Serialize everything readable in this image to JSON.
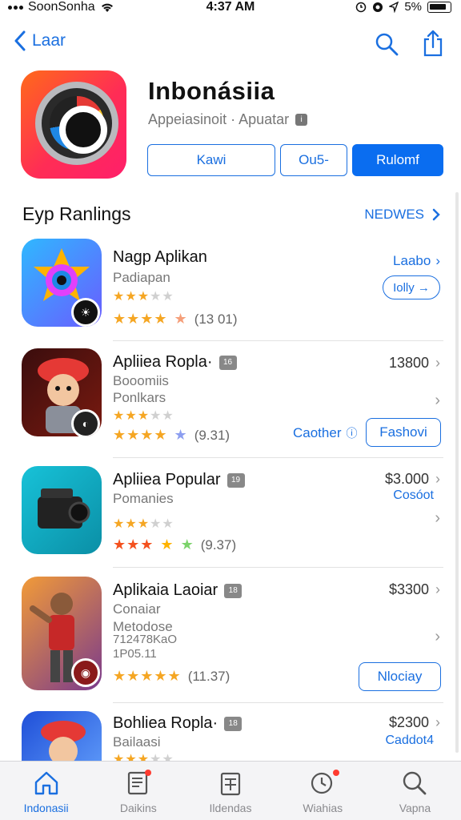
{
  "status": {
    "carrier": "SoonSonha",
    "time": "4:37 AM",
    "battery": "5%"
  },
  "nav": {
    "back_label": "Laar"
  },
  "hero": {
    "title": "Inbonásiia",
    "subtitle": "Appeiasinoit · Apuatar",
    "buttons": [
      "Kawi",
      "Ou5-",
      "Rulomf"
    ]
  },
  "section": {
    "title": "Eyp Ranlings",
    "more": "NEDWES"
  },
  "apps": [
    {
      "name": "Nagp Aplikan",
      "sub1": "Padiapan",
      "sub2": "",
      "sub3": "",
      "rating_count": "(13 01)",
      "price": "",
      "price2": "",
      "link": "Laabo",
      "link2": "",
      "button": "Iolly"
    },
    {
      "name": "Apliiea Ropla·",
      "age": "16",
      "sub1": "Booomiis",
      "sub2": "Ponlkars",
      "sub3": "",
      "rating_count": "(9.31)",
      "price": "13800",
      "price2": "",
      "link": "",
      "link2": "Caother",
      "button": "Fashovi"
    },
    {
      "name": "Apliiea Popular",
      "age": "19",
      "sub1": "Pomanies",
      "sub2": "",
      "sub3": "",
      "rating_count": "(9.37)",
      "price": "$3.000",
      "price2": "Cosóot",
      "link": "",
      "link2": "",
      "button": ""
    },
    {
      "name": "Aplikaia Laoiar",
      "age": "18",
      "sub1": "Conaiar",
      "sub2": "Metodose",
      "sub3": "712478KaO",
      "sub4": "1P05.11",
      "rating_count": "(11.37)",
      "price": "$3300",
      "price2": "",
      "link": "",
      "link2": "",
      "button": "Nlociay"
    },
    {
      "name": "Bohliea Ropla·",
      "age": "18",
      "sub1": "Bailaasi",
      "sub2": "",
      "sub3": "",
      "rating_count": "",
      "price": "$2300",
      "price2": "Caddot4",
      "link": "",
      "link2": "",
      "button": ""
    }
  ],
  "tabs": [
    "Indonasii",
    "Daikins",
    "Ildendas",
    "Wiahias",
    "Vapna"
  ]
}
